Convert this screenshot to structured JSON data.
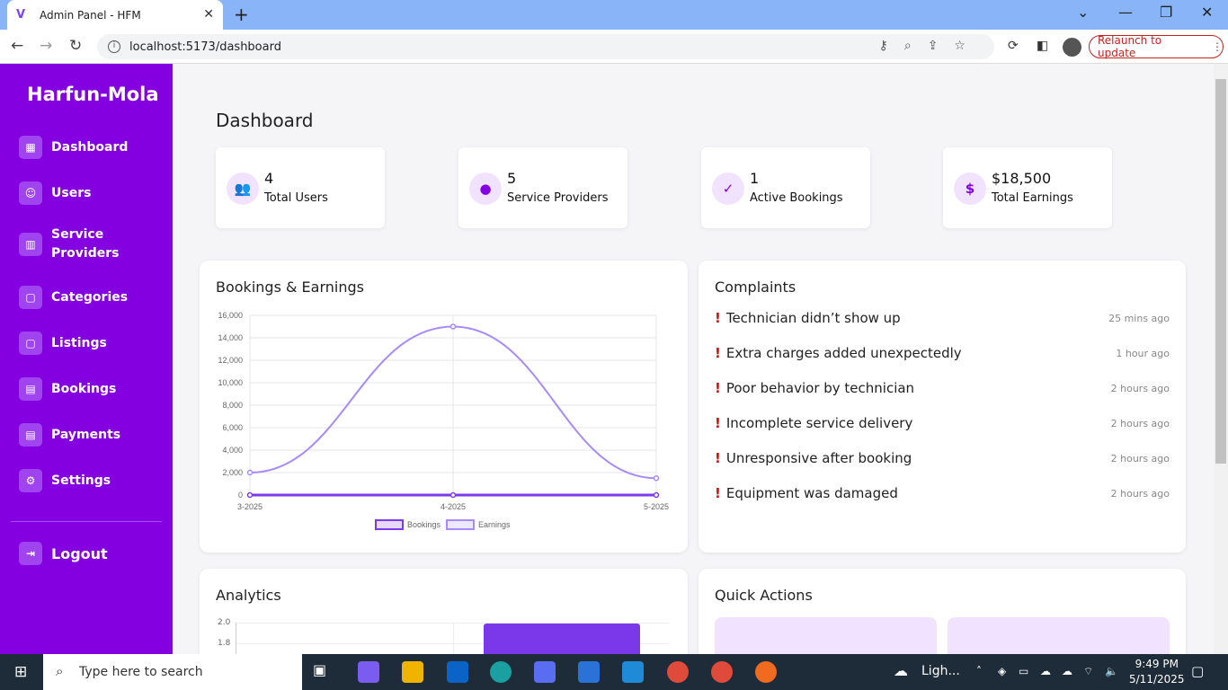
{
  "browser": {
    "tab_title": "Admin Panel - HFM",
    "url": "localhost:5173/dashboard",
    "relaunch_label": "Relaunch to update"
  },
  "sidebar": {
    "brand": "Harfun-Mola",
    "items": [
      {
        "label": "Dashboard",
        "icon": "grid-icon"
      },
      {
        "label": "Users",
        "icon": "users-icon"
      },
      {
        "label": "Service Providers",
        "icon": "building-icon"
      },
      {
        "label": "Categories",
        "icon": "clipboard-icon"
      },
      {
        "label": "Listings",
        "icon": "clipboard-icon"
      },
      {
        "label": "Bookings",
        "icon": "calendar-icon"
      },
      {
        "label": "Payments",
        "icon": "calendar-icon"
      },
      {
        "label": "Settings",
        "icon": "gear-icon"
      }
    ],
    "logout": "Logout",
    "color": "#8500e0"
  },
  "page": {
    "title": "Dashboard"
  },
  "stats": [
    {
      "value": "4",
      "label": "Total Users",
      "icon": "users-icon"
    },
    {
      "value": "5",
      "label": "Service Providers",
      "icon": "person-icon"
    },
    {
      "value": "1",
      "label": "Active Bookings",
      "icon": "calendar-check-icon"
    },
    {
      "value": "$18,500",
      "label": "Total Earnings",
      "icon": "dollar-icon"
    }
  ],
  "bookings_card": {
    "title": "Bookings & Earnings"
  },
  "complaints": {
    "title": "Complaints",
    "items": [
      {
        "text": "Technician didn’t show up",
        "time": "25 mins ago"
      },
      {
        "text": "Extra charges added unexpectedly",
        "time": "1 hour ago"
      },
      {
        "text": "Poor behavior by technician",
        "time": "2 hours ago"
      },
      {
        "text": "Incomplete service delivery",
        "time": "2 hours ago"
      },
      {
        "text": "Unresponsive after booking",
        "time": "2 hours ago"
      },
      {
        "text": "Equipment was damaged",
        "time": "2 hours ago"
      }
    ]
  },
  "analytics": {
    "title": "Analytics",
    "ticks": [
      "2.0",
      "1.8"
    ]
  },
  "quick_actions": {
    "title": "Quick Actions"
  },
  "chart_data": {
    "type": "line",
    "x": [
      "3-2025",
      "4-2025",
      "5-2025"
    ],
    "series": [
      {
        "name": "Bookings",
        "values": [
          0,
          0,
          0
        ],
        "color": "#7c3aed"
      },
      {
        "name": "Earnings",
        "values": [
          2000,
          15000,
          1500
        ],
        "color": "#a78bfa"
      }
    ],
    "ylim": [
      0,
      16000
    ],
    "yticks": [
      "0",
      "2,000",
      "4,000",
      "6,000",
      "8,000",
      "10,000",
      "12,000",
      "14,000",
      "16,000"
    ],
    "legend": "bottom",
    "grid": true
  },
  "taskbar": {
    "search_placeholder": "Type here to search",
    "weather": "Ligh...",
    "time": "9:49 PM",
    "date": "5/11/2025"
  }
}
